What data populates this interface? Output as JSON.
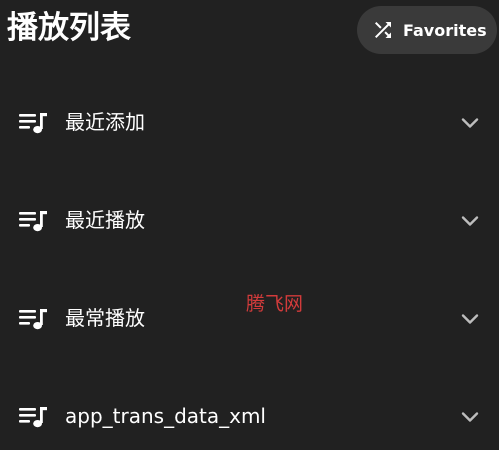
{
  "header": {
    "title": "播放列表",
    "shuffle_button": {
      "label": "Favorites",
      "icon": "shuffle-icon"
    }
  },
  "playlists": [
    {
      "label": "最近添加",
      "icon": "playlist-music-icon",
      "chevron": "chevron-down-icon"
    },
    {
      "label": "最近播放",
      "icon": "playlist-music-icon",
      "chevron": "chevron-down-icon"
    },
    {
      "label": "最常播放",
      "icon": "playlist-music-icon",
      "chevron": "chevron-down-icon"
    },
    {
      "label": "app_trans_data_xml",
      "icon": "playlist-music-icon",
      "chevron": "chevron-down-icon"
    }
  ],
  "watermark": "腾飞网",
  "colors": {
    "background": "#212121",
    "button_background": "#3a3a3a",
    "text": "#ffffff",
    "chevron": "#bdbdbd",
    "watermark": "#d23b3b"
  }
}
